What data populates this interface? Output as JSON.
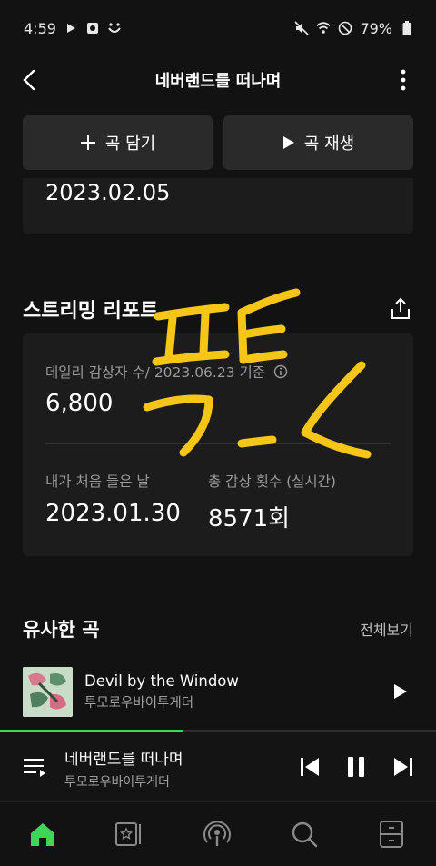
{
  "status_bar": {
    "time": "4:59",
    "battery": "79%"
  },
  "header": {
    "title": "네버랜드를 떠나며",
    "back_icon": "chevron-left-icon",
    "more_icon": "more-vertical-icon"
  },
  "actions": {
    "add_label": "곡 담기",
    "play_label": "곡 재생"
  },
  "release": {
    "date": "2023.02.05"
  },
  "report": {
    "title": "스트리밍 리포트",
    "daily_listeners_label": "데일리 감상자 수/ 2023.06.23 기준",
    "daily_listeners_value": "6,800",
    "first_listen_label": "내가 처음 들은 날",
    "first_listen_value": "2023.01.30",
    "total_plays_label": "총 감상 횟수 (실시간)",
    "total_plays_value": "8571회"
  },
  "similar": {
    "title": "유사한 곡",
    "view_all": "전체보기",
    "songs": [
      {
        "title": "Devil by the Window",
        "artist": "투모로우바이투게더"
      }
    ]
  },
  "now_playing": {
    "title": "네버랜드를 떠나며",
    "artist": "투모로우바이투게더",
    "progress": 0.42
  },
  "colors": {
    "accent": "#3ed65a",
    "annotation": "#f5c518",
    "background": "#121212",
    "card": "#1c1c1c"
  },
  "nav": {
    "items": [
      "home-icon",
      "library-icon",
      "podcast-icon",
      "search-icon",
      "storage-icon"
    ],
    "active": 0
  }
}
